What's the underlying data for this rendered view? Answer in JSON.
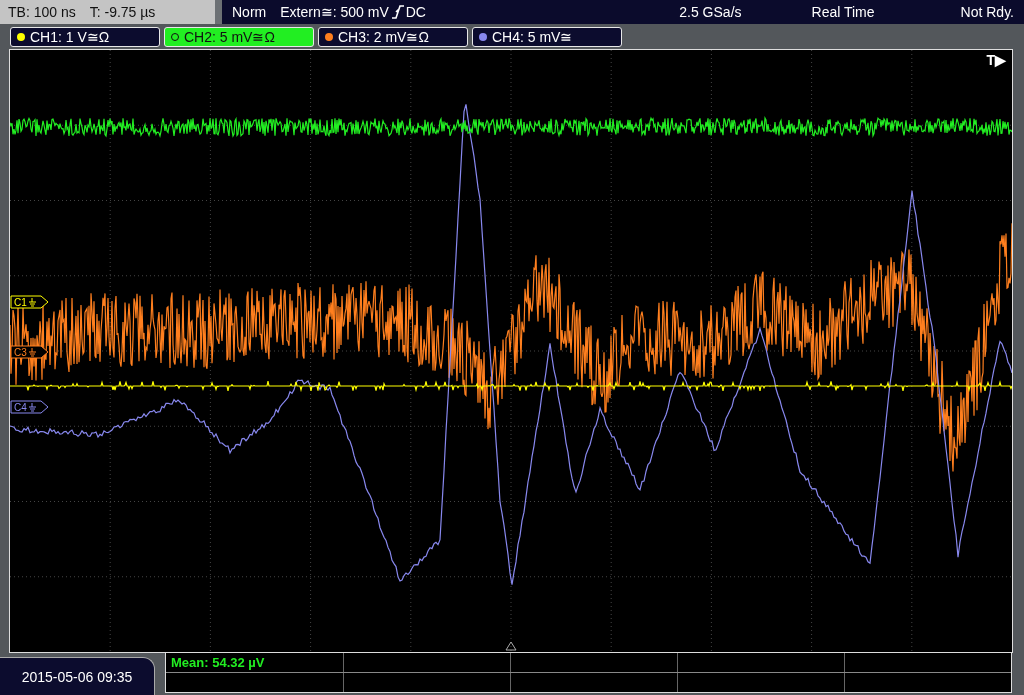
{
  "timebase": {
    "tb": "TB: 100 ns",
    "t": "T: -9.75 µs"
  },
  "acquisition": {
    "mode": "Norm",
    "trigger": "Extern≅: 500 mV",
    "coupling": "DC",
    "sample_rate": "2.5 GSa/s",
    "run_mode": "Real Time",
    "status": "Not Rdy."
  },
  "channels": [
    {
      "label": "CH1: 1 V≅Ω",
      "color": "#ffff00",
      "selected": false,
      "marker": "C1"
    },
    {
      "label": "CH2: 5 mV≅Ω",
      "color": "#22ee22",
      "selected": true
    },
    {
      "label": "CH3: 2 mV≅Ω",
      "color": "#ff7f1e",
      "selected": false,
      "marker": "C3"
    },
    {
      "label": "CH4: 5 mV≅",
      "color": "#8888ee",
      "selected": false,
      "marker": "C4"
    }
  ],
  "trigger_label": "T▶",
  "measurement": "Mean: 54.32 µV",
  "timestamp": "2015-05-06 09:35"
}
